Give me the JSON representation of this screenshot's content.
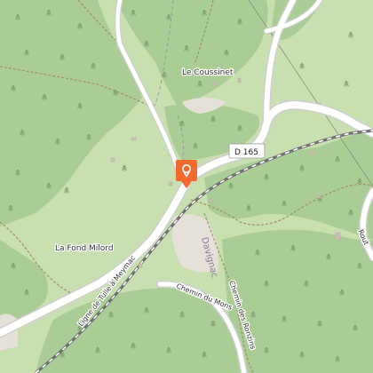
{
  "map": {
    "labels": {
      "le_coussinet": "Le Coussinet",
      "la_fond_milord": "La Fond Milord",
      "davignac": "Davignac",
      "road_d165": "D 165",
      "road_partial_right": "Rout",
      "chemin_du_mons": "Chemin du Mons",
      "chemin_des_ronzins": "Chemin des Ronzins",
      "rail_line": "Ligne de Tulle à Meymac"
    },
    "marker": {
      "icon": "poi-marker-icon",
      "color": "#f26a2e"
    },
    "colors": {
      "background": "#c8dfb0",
      "forest": "#a9cd95",
      "road": "#ffffff",
      "road_casing": "#cfcfcf",
      "rail": "#707070",
      "path": "#a38f6a",
      "builtup": "#e6e1d8"
    }
  }
}
